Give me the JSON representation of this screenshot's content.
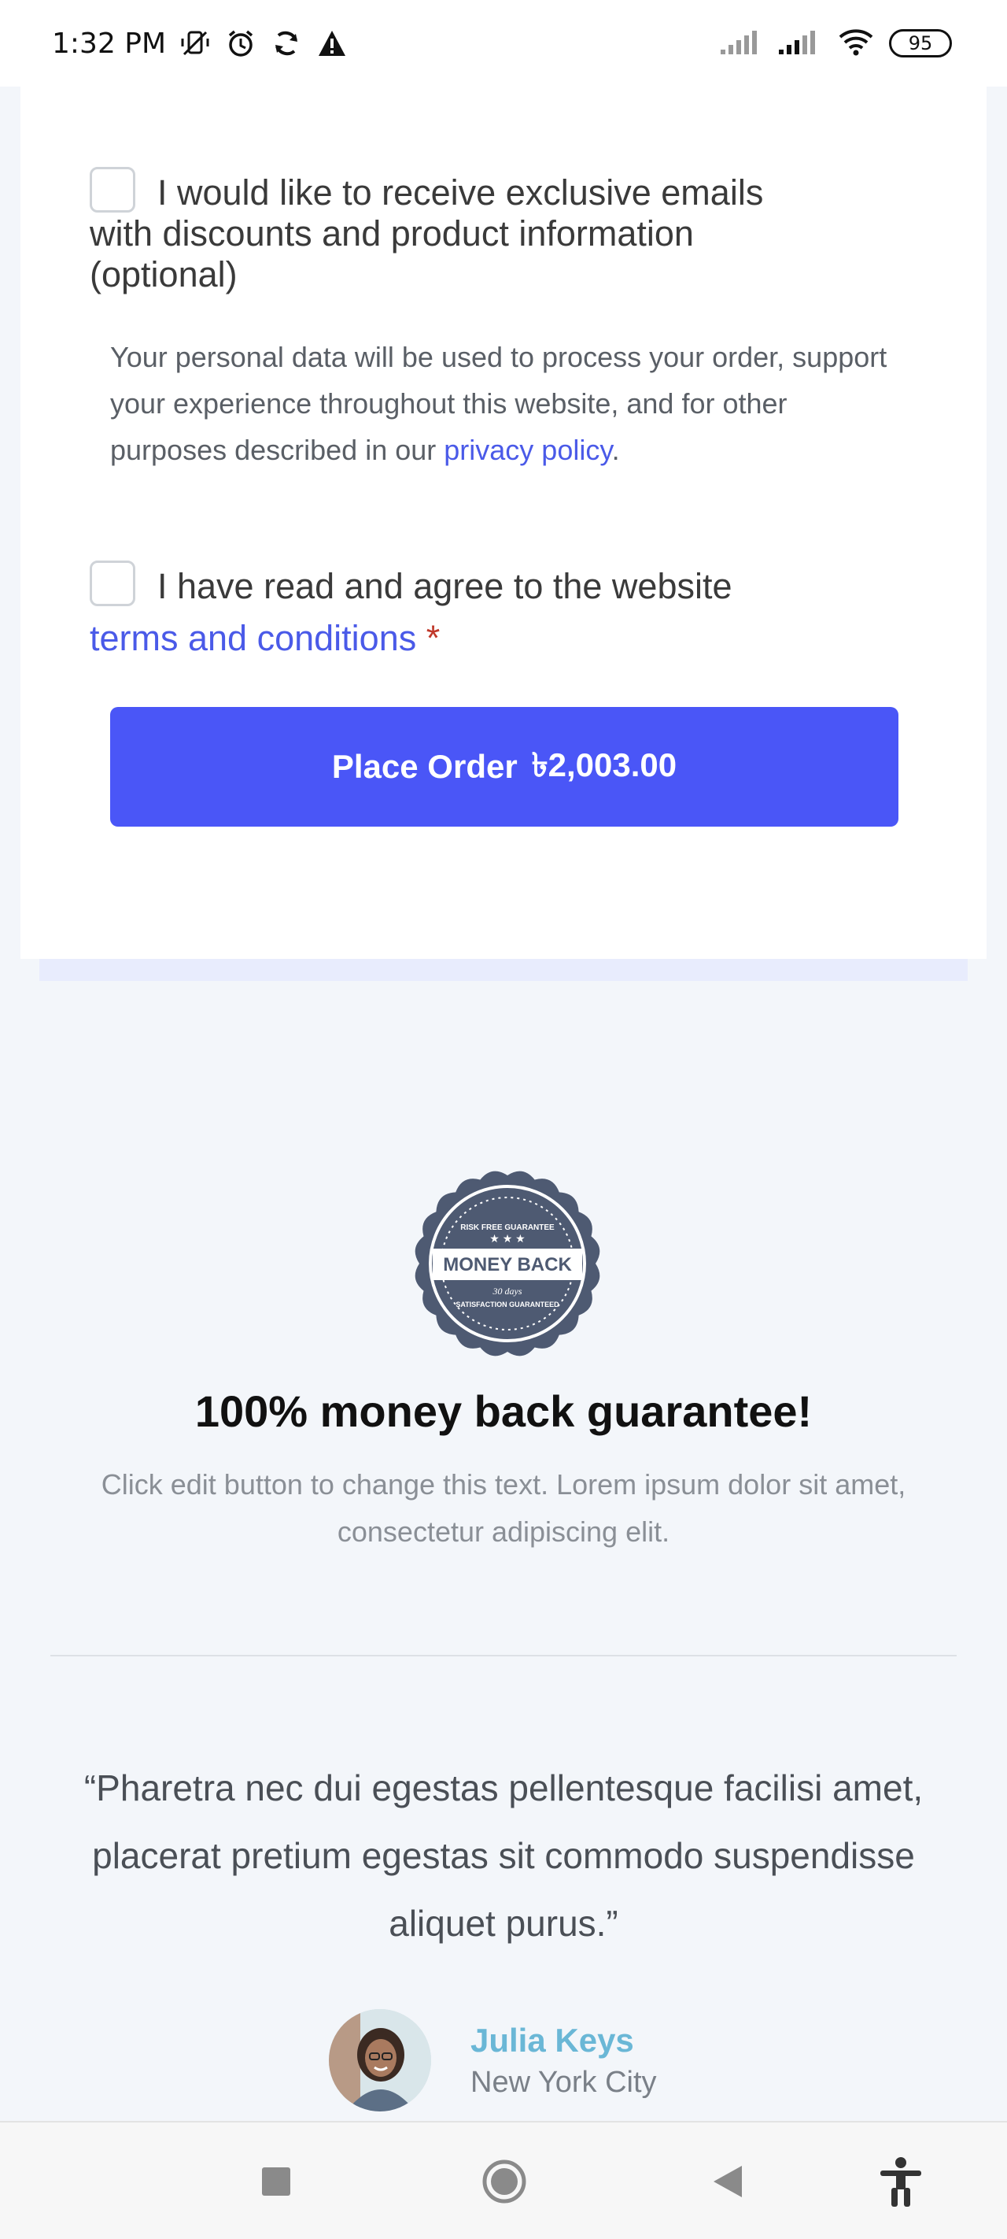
{
  "status_bar": {
    "time": "1:32 PM",
    "battery": "95",
    "icons": [
      "mute-vibrate-icon",
      "alarm-icon",
      "sync-icon",
      "warning-icon",
      "signal-icon",
      "signal-icon",
      "wifi-icon",
      "battery-icon"
    ]
  },
  "checkout": {
    "emails_opt_in_label": "I would like to receive exclusive emails with discounts and product information (optional)",
    "privacy_text": "Your personal data will be used to process your order, support your experience throughout this website, and for other purposes described in our",
    "privacy_link": "privacy policy",
    "privacy_end": ".",
    "terms_prefix": "I have read and agree to the website",
    "terms_link": "terms and conditions",
    "required_mark": "*",
    "place_order_label": "Place Order",
    "place_order_total": "৳2,003.00"
  },
  "guarantee": {
    "badge_title": "MONEY BACK",
    "badge_top_text": "RISK FREE GUARANTEE",
    "badge_days": "30 days",
    "badge_bottom_text": "SATISFACTION GUARANTEED",
    "title": "100% money back guarantee!",
    "description": "Click edit button to change this text. Lorem ipsum dolor sit amet, consectetur adipiscing elit."
  },
  "testimonial": {
    "quote": "“Pharetra nec dui egestas pellentesque facilisi amet, placerat pretium egestas sit commodo suspendisse aliquet purus.”",
    "author_name": "Julia Keys",
    "author_city": "New York City"
  },
  "colors": {
    "accent": "#4a56f7",
    "link": "#4a5ae8",
    "author_name": "#6ab7d6",
    "badge": "#4e5a72"
  },
  "nav_bar": {
    "buttons": [
      "recents-button",
      "home-button",
      "back-button",
      "accessibility-button"
    ]
  }
}
